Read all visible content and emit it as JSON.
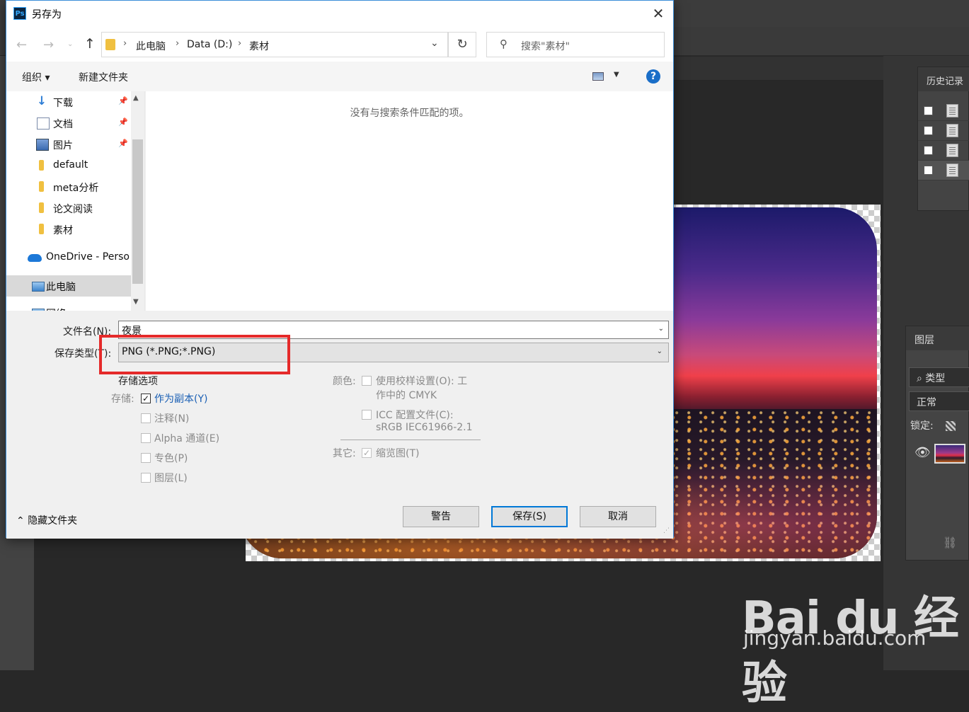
{
  "dialog": {
    "title": "另存为",
    "app_icon": "Ps",
    "nav": {
      "back_icon": "arrow-left-icon",
      "forward_icon": "arrow-right-icon",
      "breadcrumbs": [
        "此电脑",
        "Data (D:)",
        "素材"
      ],
      "search_placeholder": "搜索\"素材\""
    },
    "toolbar": {
      "organize": "组织 ▾",
      "new_folder": "新建文件夹"
    },
    "tree": [
      {
        "label": "下载",
        "icon": "download-icon",
        "pinned": true
      },
      {
        "label": "文档",
        "icon": "document-icon",
        "pinned": true
      },
      {
        "label": "图片",
        "icon": "pictures-icon",
        "pinned": true
      },
      {
        "label": "default",
        "icon": "folder-icon",
        "pinned": false
      },
      {
        "label": "meta分析",
        "icon": "folder-icon",
        "pinned": false
      },
      {
        "label": "论文阅读",
        "icon": "folder-icon",
        "pinned": false
      },
      {
        "label": "素材",
        "icon": "folder-icon",
        "pinned": false
      },
      {
        "label": "OneDrive - Perso",
        "icon": "onedrive-icon",
        "pinned": false
      },
      {
        "label": "此电脑",
        "icon": "this-pc-icon",
        "pinned": false,
        "selected": true
      },
      {
        "label": "网络",
        "icon": "network-icon",
        "pinned": false
      }
    ],
    "empty_message": "没有与搜索条件匹配的项。",
    "form": {
      "filename_label": "文件名(N):",
      "filename_value": "夜景",
      "filetype_label": "保存类型(T):",
      "filetype_value": "PNG (*.PNG;*.PNG)"
    },
    "save_options": {
      "heading": "存储选项",
      "save_label": "存储:",
      "as_copy": "作为副本(Y)",
      "notes": "注释(N)",
      "alpha": "Alpha 通道(E)",
      "spot": "专色(P)",
      "layers": "图层(L)"
    },
    "color_options": {
      "color_label": "颜色:",
      "proof": "使用校样设置(O): 工",
      "proof_line2": "作中的 CMYK",
      "icc": "ICC 配置文件(C):",
      "icc_line2": "sRGB IEC61966-2.1",
      "other_label": "其它:",
      "thumbnail": "缩览图(T)"
    },
    "buttons": {
      "warning": "警告",
      "save": "保存(S)",
      "cancel": "取消"
    },
    "hide_folders": "隐藏文件夹"
  },
  "photoshop": {
    "history_title": "历史记录",
    "layers_tab": "图层",
    "layers_filter": "类型",
    "blend_mode": "正常",
    "lock_label": "锁定:"
  },
  "watermark": {
    "brand": "Bai du 经验",
    "url": "jingyan.baidu.com"
  },
  "colors": {
    "highlight_box": "#e52a2a",
    "accent": "#0078d7"
  }
}
